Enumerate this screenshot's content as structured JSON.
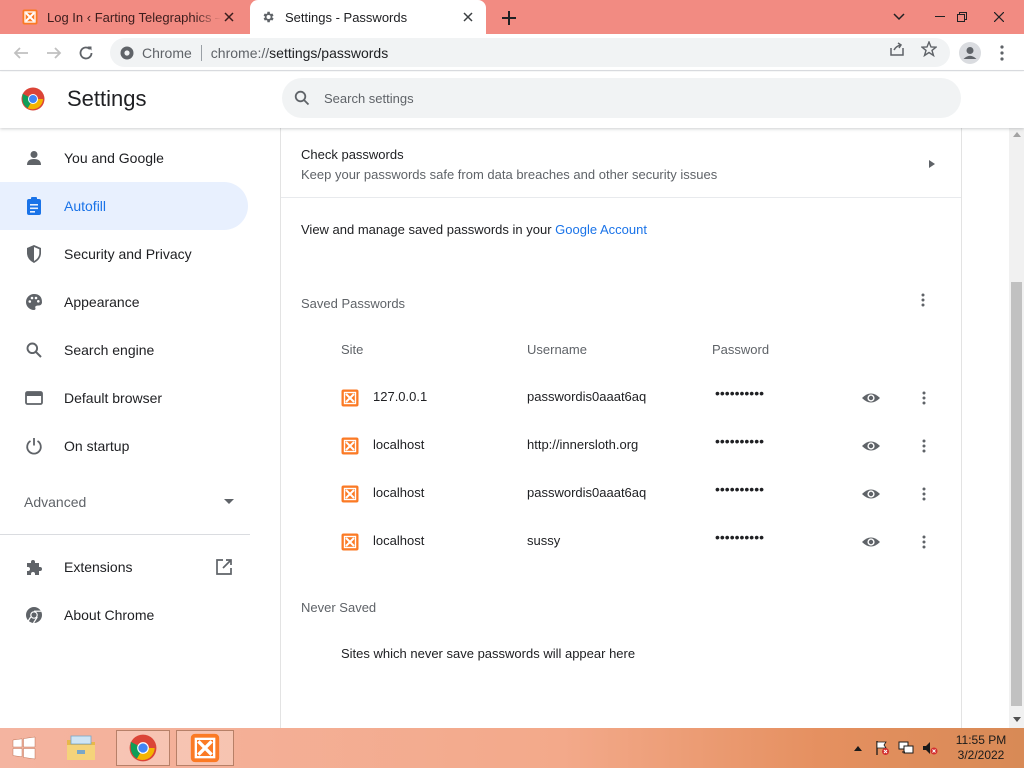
{
  "browser": {
    "tabs": [
      {
        "title": "Log In ‹ Farting Telegraphics — WordPress",
        "active": false,
        "favicon": "xampp-icon"
      },
      {
        "title": "Settings - Passwords",
        "active": true,
        "favicon": "gear-icon"
      }
    ],
    "omnibox": {
      "chip_label": "Chrome",
      "url_scheme": "chrome://",
      "url_path": "settings/passwords"
    }
  },
  "settings": {
    "title": "Settings",
    "search_placeholder": "Search settings"
  },
  "sidebar": {
    "items": [
      {
        "label": "You and Google",
        "icon": "person-icon",
        "active": false
      },
      {
        "label": "Autofill",
        "icon": "clipboard-icon",
        "active": true
      },
      {
        "label": "Security and Privacy",
        "icon": "shield-icon",
        "active": false
      },
      {
        "label": "Appearance",
        "icon": "palette-icon",
        "active": false
      },
      {
        "label": "Search engine",
        "icon": "search-icon",
        "active": false
      },
      {
        "label": "Default browser",
        "icon": "browser-window-icon",
        "active": false
      },
      {
        "label": "On startup",
        "icon": "power-icon",
        "active": false
      }
    ],
    "advanced_label": "Advanced",
    "extensions_label": "Extensions",
    "about_label": "About Chrome"
  },
  "passwords": {
    "check_title": "Check passwords",
    "check_subtitle": "Keep your passwords safe from data breaches and other security issues",
    "manage_text": "View and manage saved passwords in your ",
    "manage_link": "Google Account",
    "saved_title": "Saved Passwords",
    "columns": {
      "site": "Site",
      "username": "Username",
      "password": "Password"
    },
    "entries": [
      {
        "site": "127.0.0.1",
        "username": "passwordis0aaat6aq",
        "password": "••••••••••"
      },
      {
        "site": "localhost",
        "username": "http://innersloth.org",
        "password": "••••••••••"
      },
      {
        "site": "localhost",
        "username": "passwordis0aaat6aq",
        "password": "••••••••••"
      },
      {
        "site": "localhost",
        "username": "sussy",
        "password": "••••••••••"
      }
    ],
    "never_title": "Never Saved",
    "never_empty": "Sites which never save passwords will appear here"
  },
  "taskbar": {
    "time": "11:55 PM",
    "date": "3/2/2022"
  },
  "colors": {
    "tabstrip": "#f28b82",
    "accent": "#1a73e8",
    "active_nav_bg": "#e8f0fe",
    "xampp_orange": "#fb7a24"
  }
}
